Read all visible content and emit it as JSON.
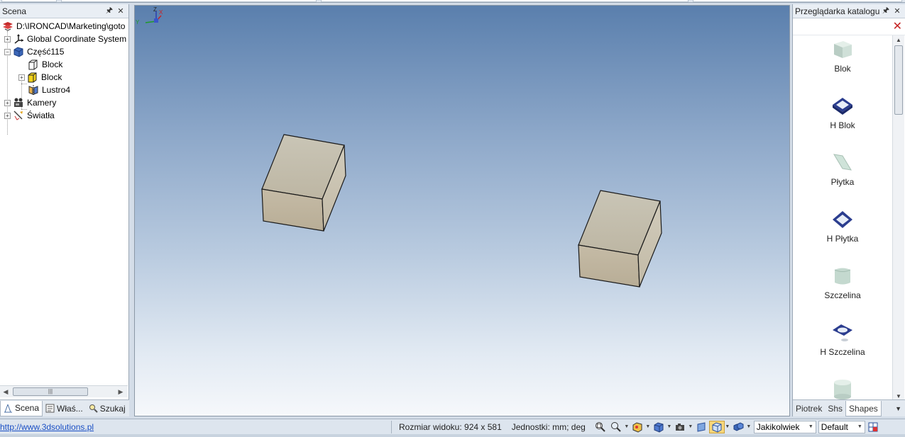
{
  "left_panel": {
    "title": "Scena",
    "pin_icon": "pin-icon",
    "tree": [
      {
        "label": "D:\\IRONCAD\\Marketing\\goto",
        "icon": "scene-root-icon"
      },
      {
        "label": "Global Coordinate System",
        "icon": "coordinate-system-icon"
      },
      {
        "label": "Część115",
        "icon": "part-icon"
      },
      {
        "label": "Block",
        "icon": "block-outline-icon"
      },
      {
        "label": "Block",
        "icon": "block-yellow-icon"
      },
      {
        "label": "Lustro4",
        "icon": "mirror-icon"
      },
      {
        "label": "Kamery",
        "icon": "camera-icon"
      },
      {
        "label": "Światła",
        "icon": "light-icon"
      }
    ],
    "tabs": [
      {
        "label": "Scena",
        "icon": "scene-tab-icon"
      },
      {
        "label": "Właś...",
        "icon": "properties-tab-icon"
      },
      {
        "label": "Szukaj",
        "icon": "search-icon"
      }
    ]
  },
  "viewport": {
    "axis_labels": {
      "z": "Z",
      "x": "X",
      "y": "Y"
    }
  },
  "right_panel": {
    "title": "Przeglądarka katalogu",
    "catalog_items": [
      {
        "label": "Blok",
        "icon": "block-shape-icon"
      },
      {
        "label": "H Blok",
        "icon": "hollow-block-shape-icon"
      },
      {
        "label": "Płytka",
        "icon": "plate-shape-icon"
      },
      {
        "label": "H Płytka",
        "icon": "hollow-plate-shape-icon"
      },
      {
        "label": "Szczelina",
        "icon": "slot-shape-icon"
      },
      {
        "label": "H Szczelina",
        "icon": "hollow-slot-shape-icon"
      },
      {
        "label": "",
        "icon": "cylinder-shape-icon"
      }
    ],
    "tabs": [
      "Piotrek",
      "Shs",
      "Shapes"
    ]
  },
  "statusbar": {
    "link": "http://www.3dsolutions.pl",
    "view_size": "Rozmiar widoku:  924 x  581",
    "units": "Jednostki: mm; deg",
    "filter_combo": "Jakikolwiek",
    "style_combo": "Default"
  },
  "colors": {
    "viewport_top": "#5a7fad",
    "viewport_bottom": "#f6f8fb",
    "block_face": "#c9c0ad",
    "accent_red": "#c42121"
  }
}
